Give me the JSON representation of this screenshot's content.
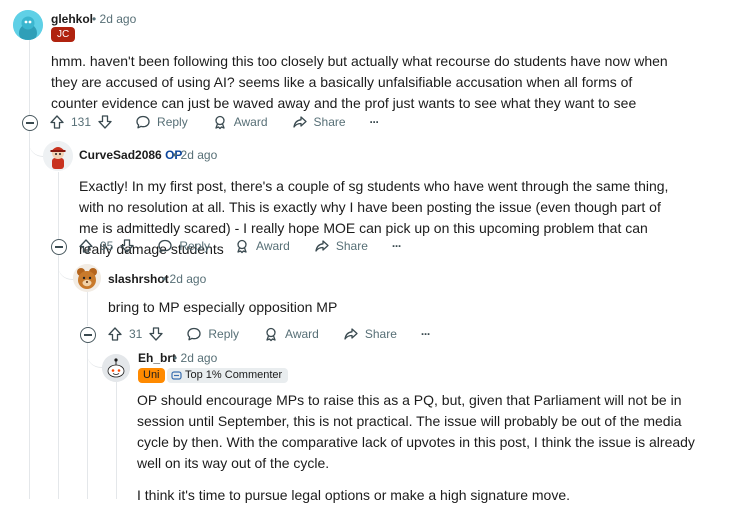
{
  "comments": [
    {
      "username": "glehkol",
      "time": "2d ago",
      "flair": "JC",
      "body": "hmm. haven't been following this too closely but actually what recourse do students have now when they are accused of using AI? seems like a basically unfalsifiable accusation when all forms of counter evidence can just be waved away and the prof just wants to see what they want to see",
      "votes": "131"
    },
    {
      "username": "CurveSad2086",
      "op_label": "OP",
      "time": "2d ago",
      "body": "Exactly! In my first post, there's a couple of sg students who have went through the same thing, with no resolution at all. This is exactly why I have been posting the issue (even though part of me is admittedly scared) - I really hope MOE can pick up on this upcoming problem that can really damage students",
      "votes": "95"
    },
    {
      "username": "slashrshot",
      "time": "2d ago",
      "body": "bring to MP especially opposition MP",
      "votes": "31"
    },
    {
      "username": "Eh_brt",
      "time": "2d ago",
      "flair_uni": "Uni",
      "flair_top": "Top 1% Commenter",
      "body_p1": "OP should encourage MPs to raise this as a PQ, but, given that Parliament will not be in session until September, this is not practical. The issue will probably be out of the media cycle by then. With the comparative lack of upvotes in this post, I think the issue is already well on its way out of the cycle.",
      "body_p2": "I think it's time to pursue legal options or make a high signature move."
    }
  ],
  "actions": {
    "reply": "Reply",
    "award": "Award",
    "share": "Share",
    "more": "···",
    "separator": "•"
  },
  "colors": {
    "meta": "#576f76",
    "op": "#0a449b",
    "jc_flair": "#b0230f",
    "uni_flair": "#ff8a00",
    "thread_line": "#e4e7ea"
  },
  "icons": [
    "upvote-icon",
    "downvote-icon",
    "reply-icon",
    "award-icon",
    "share-icon",
    "more-icon",
    "collapse-icon",
    "medal-icon"
  ]
}
